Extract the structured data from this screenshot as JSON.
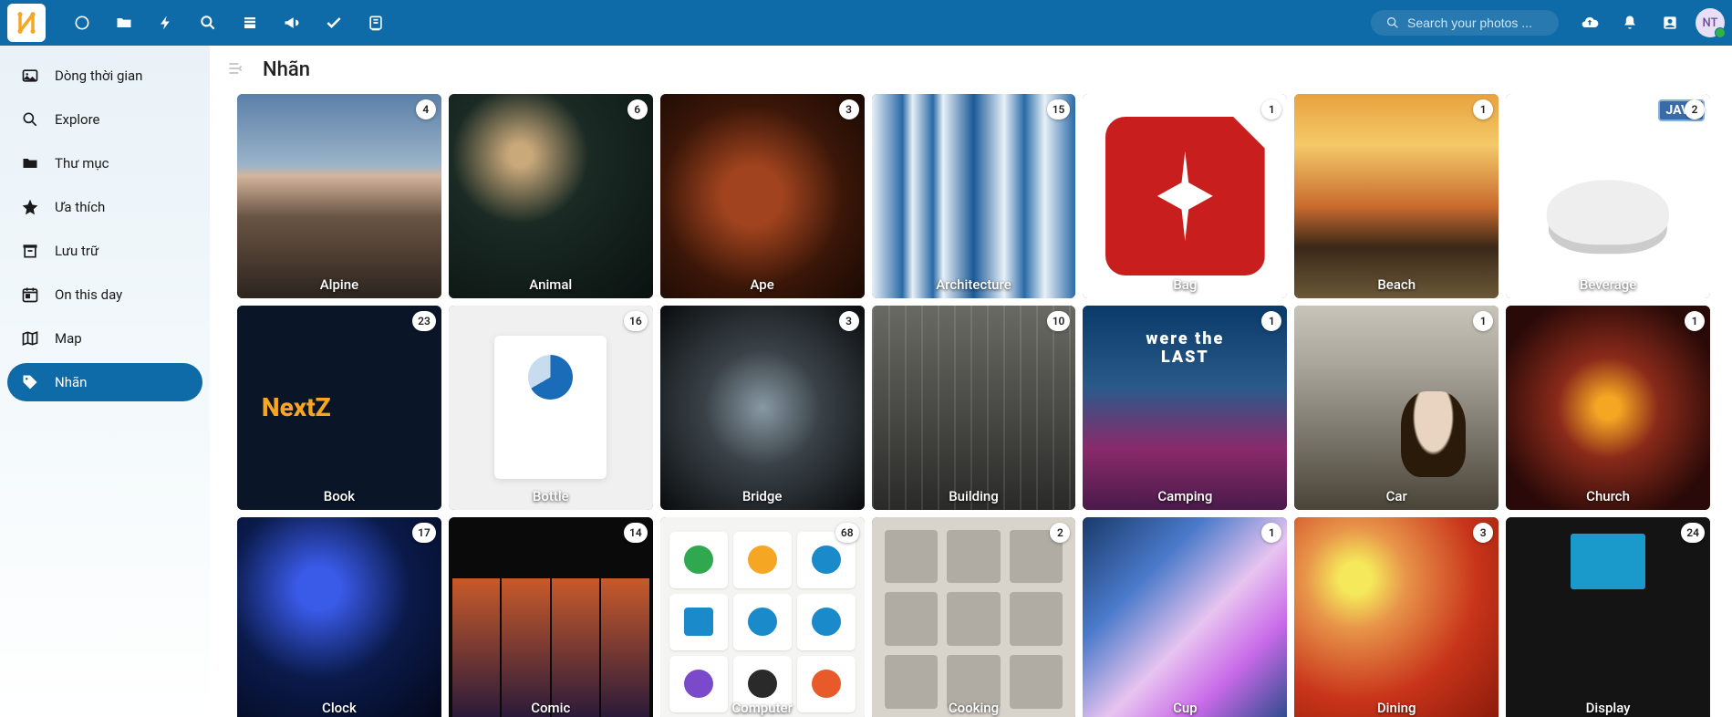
{
  "topbar": {
    "search_placeholder": "Search your photos ...",
    "avatar_initials": "NT"
  },
  "sidebar": {
    "items": [
      {
        "label": "Dòng thời gian",
        "icon": "image"
      },
      {
        "label": "Explore",
        "icon": "search"
      },
      {
        "label": "Thư mục",
        "icon": "folder"
      },
      {
        "label": "Ưa thích",
        "icon": "star"
      },
      {
        "label": "Lưu trữ",
        "icon": "archive"
      },
      {
        "label": "On this day",
        "icon": "calendar"
      },
      {
        "label": "Map",
        "icon": "map"
      },
      {
        "label": "Nhãn",
        "icon": "tag",
        "active": true
      }
    ]
  },
  "page": {
    "title": "Nhãn"
  },
  "tags": [
    {
      "name": "Alpine",
      "count": 4,
      "thumb": "t-alpine"
    },
    {
      "name": "Animal",
      "count": 6,
      "thumb": "t-animal"
    },
    {
      "name": "Ape",
      "count": 3,
      "thumb": "t-ape"
    },
    {
      "name": "Architecture",
      "count": 15,
      "thumb": "t-architecture"
    },
    {
      "name": "Bag",
      "count": 1,
      "thumb": "t-bag"
    },
    {
      "name": "Beach",
      "count": 1,
      "thumb": "t-beach"
    },
    {
      "name": "Beverage",
      "count": 2,
      "thumb": "t-beverage"
    },
    {
      "name": "Book",
      "count": 23,
      "thumb": "t-book"
    },
    {
      "name": "Bottle",
      "count": 16,
      "thumb": "t-bottle"
    },
    {
      "name": "Bridge",
      "count": 3,
      "thumb": "t-bridge"
    },
    {
      "name": "Building",
      "count": 10,
      "thumb": "t-building"
    },
    {
      "name": "Camping",
      "count": 1,
      "thumb": "t-camping"
    },
    {
      "name": "Car",
      "count": 1,
      "thumb": "t-car"
    },
    {
      "name": "Church",
      "count": 1,
      "thumb": "t-church"
    },
    {
      "name": "Clock",
      "count": 17,
      "thumb": "t-clock"
    },
    {
      "name": "Comic",
      "count": 14,
      "thumb": "t-comic"
    },
    {
      "name": "Computer",
      "count": 68,
      "thumb": "t-computer"
    },
    {
      "name": "Cooking",
      "count": 2,
      "thumb": "t-cooking"
    },
    {
      "name": "Cup",
      "count": 1,
      "thumb": "t-cup"
    },
    {
      "name": "Dining",
      "count": 3,
      "thumb": "t-dining"
    },
    {
      "name": "Display",
      "count": 24,
      "thumb": "t-display"
    }
  ]
}
